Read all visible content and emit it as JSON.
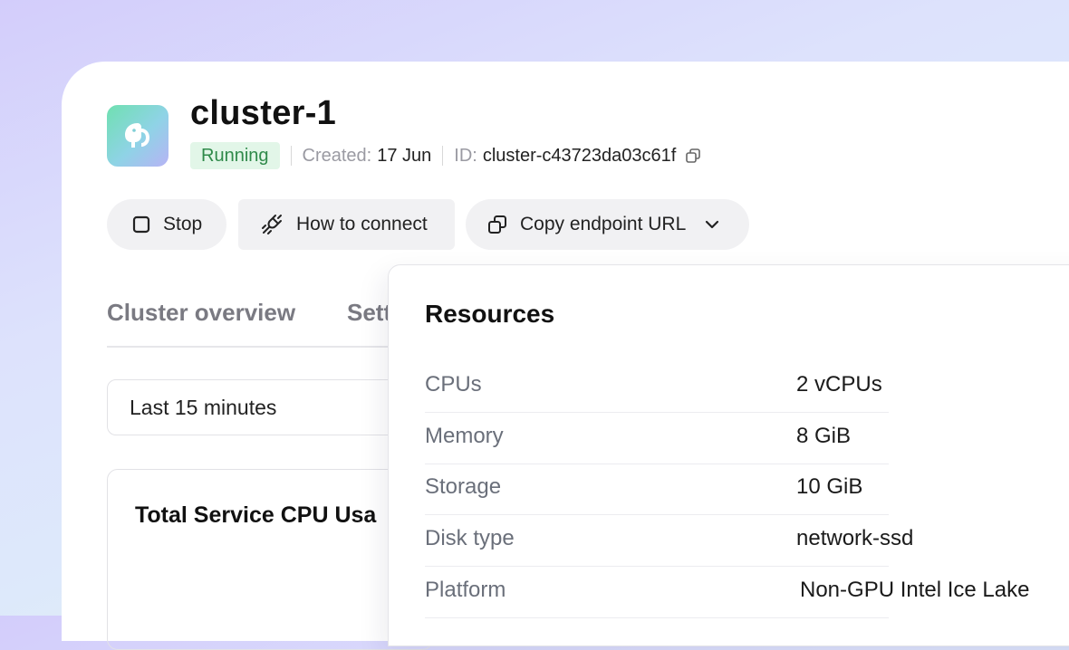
{
  "header": {
    "title": "cluster-1",
    "status": "Running",
    "created_label": "Created:",
    "created_value": "17 Jun",
    "id_label": "ID:",
    "id_value": "cluster-c43723da03c61f"
  },
  "toolbar": {
    "stop_label": "Stop",
    "connect_label": "How to connect",
    "copy_label": "Copy endpoint URL"
  },
  "tabs": [
    {
      "label": "Cluster overview"
    },
    {
      "label": "Sett"
    }
  ],
  "time_range": {
    "value": "Last 15 minutes"
  },
  "chart_card": {
    "title": "Total Service CPU Usa"
  },
  "resources": {
    "title": "Resources",
    "rows": [
      {
        "key": "CPUs",
        "value": "2 vCPUs"
      },
      {
        "key": "Memory",
        "value": "8 GiB"
      },
      {
        "key": "Storage",
        "value": "10 GiB"
      },
      {
        "key": "Disk type",
        "value": "network-ssd"
      },
      {
        "key": "Platform",
        "value": "Non-GPU Intel Ice Lake"
      }
    ]
  },
  "colors": {
    "status_bg": "#e2f6e8",
    "status_text": "#2f8a4a",
    "button_bg": "#f1f1f3"
  },
  "icons": {
    "logo": "elephant-logo-icon",
    "id_copy": "copy-icon",
    "stop": "stop-square-icon",
    "connect": "plug-icon",
    "copy": "copy-icon",
    "dropdown": "chevron-down-icon"
  }
}
